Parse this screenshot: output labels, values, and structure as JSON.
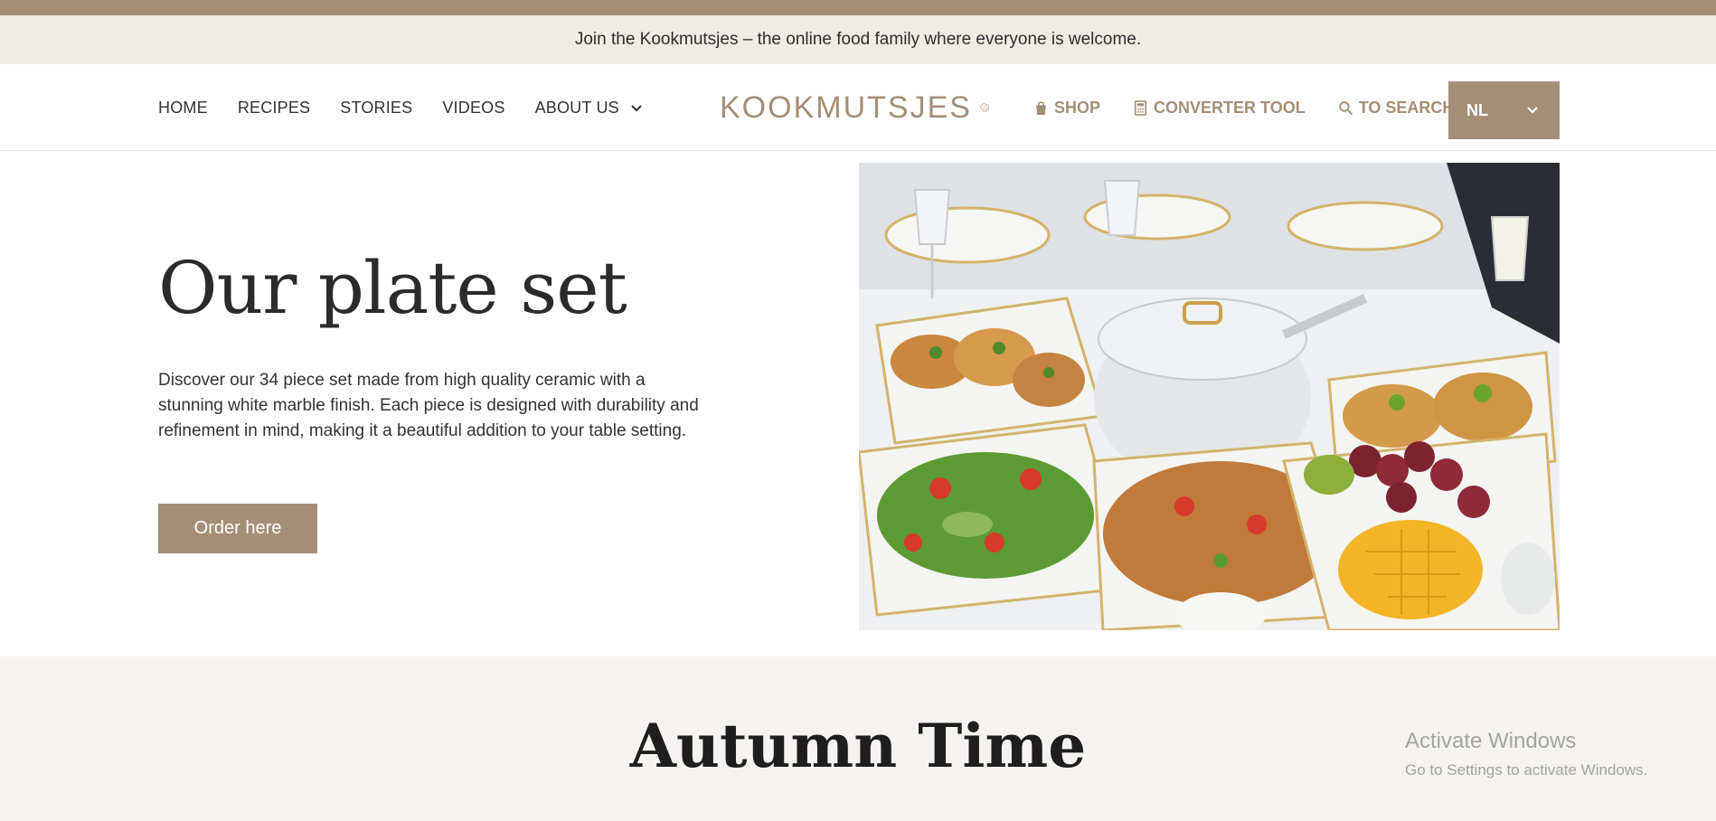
{
  "announcement": "Join the Kookmutsjes – the online food family where everyone is welcome.",
  "nav": {
    "items": [
      "HOME",
      "RECIPES",
      "STORIES",
      "VIDEOS",
      "ABOUT US"
    ]
  },
  "logo": {
    "text": "KOOKMUTSJES"
  },
  "utility": {
    "shop": "SHOP",
    "converter": "CONVERTER TOOL",
    "search": "TO SEARCH"
  },
  "language": {
    "selected": "NL"
  },
  "hero": {
    "title": "Our plate set",
    "description": "Discover our 34 piece set made from high quality ceramic with a stunning white marble finish. Each piece is designed with durability and refinement in mind, making it a beautiful addition to your table setting.",
    "button": "Order here"
  },
  "section2": {
    "title": "Autumn Time"
  },
  "watermark": {
    "title": "Activate Windows",
    "subtitle": "Go to Settings to activate Windows."
  },
  "colors": {
    "brand": "#a48f76",
    "announce_bg": "#efebe5",
    "section_bg": "#f5f3ef"
  }
}
